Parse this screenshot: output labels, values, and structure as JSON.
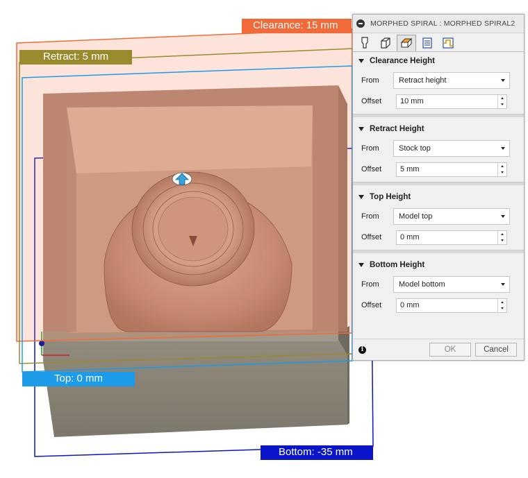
{
  "viewport": {
    "plane_labels": {
      "clearance": "Clearance: 15 mm",
      "retract": "Retract: 5 mm",
      "top": "Top: 0 mm",
      "bottom": "Bottom: -35 mm"
    },
    "colors": {
      "clearance": "#f26a3a",
      "retract": "#9a8a2e",
      "top": "#1c9be8",
      "bottom": "#0a14c8",
      "stock": "#b89080",
      "base": "#8a8474"
    }
  },
  "panel": {
    "title": "MORPHED SPIRAL : MORPHED SPIRAL2",
    "tabs": [
      {
        "icon": "tool-icon"
      },
      {
        "icon": "geometry-icon"
      },
      {
        "icon": "heights-icon",
        "active": true
      },
      {
        "icon": "passes-icon"
      },
      {
        "icon": "linking-icon"
      }
    ],
    "sections": [
      {
        "title": "Clearance Height",
        "from_label": "From",
        "from_value": "Retract height",
        "offset_label": "Offset",
        "offset_value": "10 mm"
      },
      {
        "title": "Retract Height",
        "from_label": "From",
        "from_value": "Stock top",
        "offset_label": "Offset",
        "offset_value": "5 mm"
      },
      {
        "title": "Top Height",
        "from_label": "From",
        "from_value": "Model top",
        "offset_label": "Offset",
        "offset_value": "0 mm"
      },
      {
        "title": "Bottom Height",
        "from_label": "From",
        "from_value": "Model bottom",
        "offset_label": "Offset",
        "offset_value": "0 mm"
      }
    ],
    "footer": {
      "ok_label": "OK",
      "cancel_label": "Cancel"
    }
  }
}
